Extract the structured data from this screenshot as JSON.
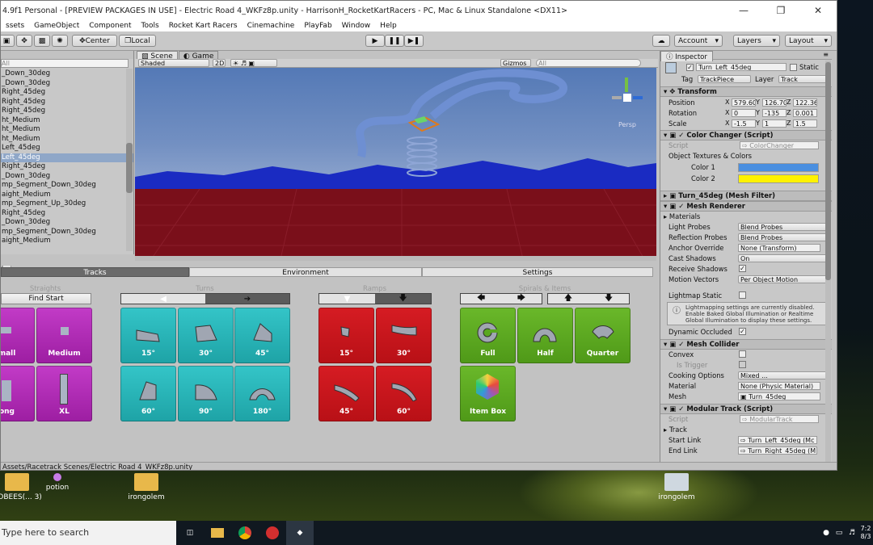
{
  "window": {
    "title": "4.9f1 Personal - [PREVIEW PACKAGES IN USE] - Electric Road 4_WKFz8p.unity - HarrisonH_RocketKartRacers - PC, Mac & Linux Standalone <DX11>"
  },
  "menu": [
    "ssets",
    "GameObject",
    "Component",
    "Tools",
    "Rocket Kart Racers",
    "Cinemachine",
    "PlayFab",
    "Window",
    "Help"
  ],
  "toolbar": {
    "center": "Center",
    "local": "Local",
    "account": "Account",
    "layers": "Layers",
    "layout": "Layout"
  },
  "hierarchy": {
    "search": "All",
    "items": [
      "_Down_30deg",
      "_Down_30deg",
      "Right_45deg",
      "Right_45deg",
      "Right_45deg",
      "ht_Medium",
      "ht_Medium",
      "ht_Medium",
      "Left_45deg",
      "Left_45deg",
      "Right_45deg",
      "_Down_30deg",
      "mp_Segment_Down_30deg",
      "aight_Medium",
      "mp_Segment_Up_30deg",
      "Right_45deg",
      "_Down_30deg",
      "mp_Segment_Down_30deg",
      "aight_Medium"
    ],
    "selected_index": 9
  },
  "scene": {
    "tabs": [
      "Scene",
      "Game"
    ],
    "shading": "Shaded",
    "mode2d": "2D",
    "gizmos": "Gizmos",
    "search": "All",
    "persp": "Persp"
  },
  "bottom_tabs": [
    "Tracks",
    "Environment",
    "Settings"
  ],
  "sections": {
    "straights": "Straights",
    "turns": "Turns",
    "ramps": "Ramps",
    "spirals": "Spirals & Items"
  },
  "find_start": "Find Start",
  "straights": [
    "mall",
    "Medium",
    "ong",
    "XL"
  ],
  "turns": [
    "15°",
    "30°",
    "45°",
    "60°",
    "90°",
    "180°"
  ],
  "ramps": [
    "15°",
    "30°",
    "45°",
    "60°"
  ],
  "spirals": [
    "Full",
    "Half",
    "Quarter",
    "Item Box"
  ],
  "inspector": {
    "tab": "Inspector",
    "object_name": "Turn_Left_45deg",
    "static": "Static",
    "tag_label": "Tag",
    "tag": "TrackPiece",
    "layer_label": "Layer",
    "layer": "Track",
    "transform": {
      "title": "Transform",
      "position_label": "Position",
      "rotation_label": "Rotation",
      "scale_label": "Scale",
      "pos": [
        "579.60",
        "126.70",
        "122.36"
      ],
      "rot": [
        "0",
        "-135",
        "0.001"
      ],
      "scale": [
        "-1.5",
        "1",
        "1.5"
      ]
    },
    "color_changer": {
      "title": "Color Changer (Script)",
      "script_label": "Script",
      "script": "ColorChanger",
      "textures_label": "Object Textures & Colors",
      "color1": "Color 1",
      "color2": "Color 2",
      "color1_hex": "#4a8fe0",
      "color2_hex": "#fff200"
    },
    "mesh_filter": {
      "title": "Turn_45deg (Mesh Filter)"
    },
    "mesh_renderer": {
      "title": "Mesh Renderer",
      "materials": "Materials",
      "light_probes": "Light Probes",
      "light_probes_val": "Blend Probes",
      "reflection_probes": "Reflection Probes",
      "reflection_probes_val": "Blend Probes",
      "anchor": "Anchor Override",
      "anchor_val": "None (Transform)",
      "cast": "Cast Shadows",
      "cast_val": "On",
      "receive": "Receive Shadows",
      "motion": "Motion Vectors",
      "motion_val": "Per Object Motion",
      "lightmap": "Lightmap Static",
      "info": "Lightmapping settings are currently disabled. Enable Baked Global Illumination or Realtime Global Illumination to display these settings.",
      "dynamic": "Dynamic Occluded"
    },
    "mesh_collider": {
      "title": "Mesh Collider",
      "convex": "Convex",
      "trigger": "Is Trigger",
      "cooking": "Cooking Options",
      "cooking_val": "Mixed ...",
      "material": "Material",
      "material_val": "None (Physic Material)",
      "mesh": "Mesh",
      "mesh_val": "Turn_45deg"
    },
    "modular": {
      "title": "Modular Track (Script)",
      "script_label": "Script",
      "script": "ModularTrack",
      "track": "Track",
      "start": "Start Link",
      "start_val": "Turn_Left_45deg (Mc",
      "end": "End Link",
      "end_val": "Turn_Right_45deg (M"
    }
  },
  "status": "Assets/Racetrack Scenes/Electric Road 4_WKFz8p.unity",
  "desktop": {
    "icons": [
      "OOBEES(...\n3)",
      "potion",
      "irongolem",
      "irongolem"
    ]
  },
  "taskbar": {
    "search": "Type here to search",
    "time": "7:2",
    "date": "8/3"
  }
}
